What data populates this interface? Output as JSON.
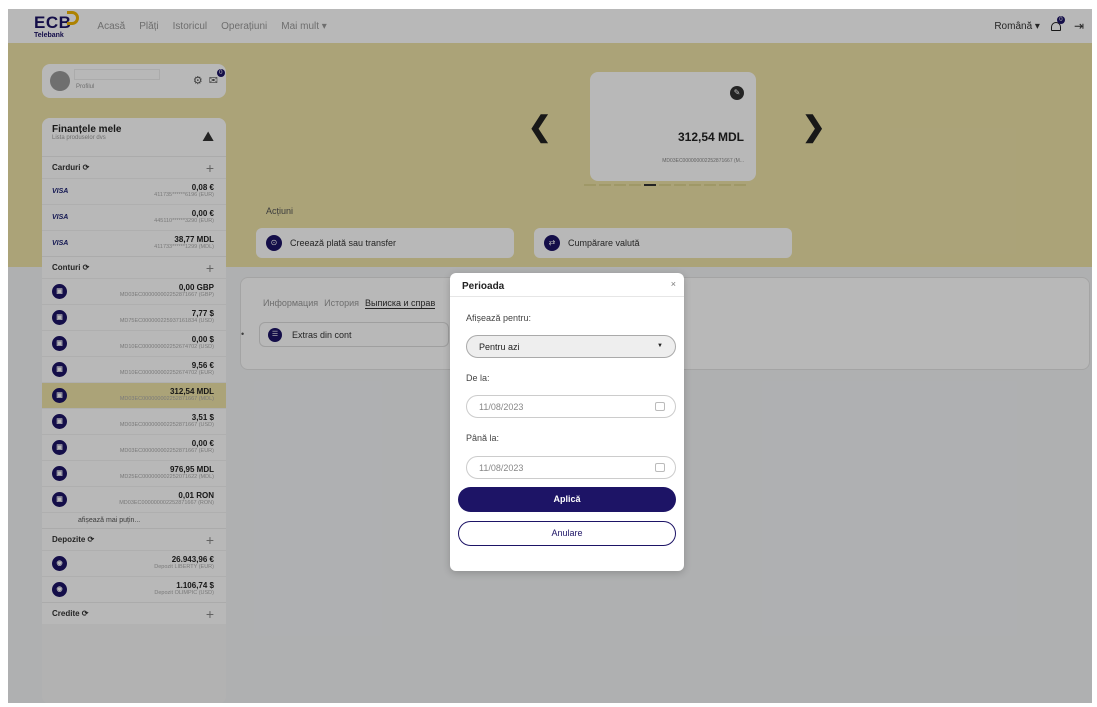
{
  "brand": {
    "logo": "ECB",
    "sub": "Telebank"
  },
  "nav": [
    "Acasă",
    "Plăți",
    "Istoricul",
    "Operațiuni",
    "Mai mult ▾"
  ],
  "header": {
    "language": "Română ▾",
    "notif_count": "0"
  },
  "profile": {
    "link": "Profilul",
    "msg_count": "0"
  },
  "finances": {
    "title": "Finanțele mele",
    "subtitle": "Lista produselor dvs"
  },
  "sections": {
    "cards": "Carduri ⟳",
    "accounts": "Conturi ⟳",
    "deposits": "Depozite ⟳",
    "credits": "Credite ⟳",
    "plus": "+"
  },
  "cards": [
    {
      "brand": "VISA",
      "amount": "0,08 €",
      "num": "411735******6196 (EUR)"
    },
    {
      "brand": "VISA",
      "amount": "0,00 €",
      "num": "445110******3290 (EUR)"
    },
    {
      "brand": "VISA",
      "amount": "38,77 MDL",
      "num": "411733******1299 (MDL)"
    }
  ],
  "accounts": [
    {
      "amount": "0,00 GBP",
      "iban": "MD03EC000000002252871667 (GBP)"
    },
    {
      "amount": "7,77 $",
      "iban": "MD75EC000000225937161834 (USD)"
    },
    {
      "amount": "0,00 $",
      "iban": "MD10EC000000002252674702 (USD)"
    },
    {
      "amount": "9,56 €",
      "iban": "MD10EC000000002252674702 (EUR)"
    },
    {
      "amount": "312,54 MDL",
      "iban": "MD03EC000000002252871667 (MDL)"
    },
    {
      "amount": "3,51 $",
      "iban": "MD03EC000000002252871667 (USD)"
    },
    {
      "amount": "0,00 €",
      "iban": "MD03EC000000002252871667 (EUR)"
    },
    {
      "amount": "976,95 MDL",
      "iban": "MD25EC000000002252071622 (MDL)"
    },
    {
      "amount": "0,01 RON",
      "iban": "MD03EC000000002252871667 (RON)"
    }
  ],
  "show_less": "afișează mai puțin...",
  "deposits": [
    {
      "amount": "26.943,96 €",
      "name": "Depozit LIBERTY (EUR)"
    },
    {
      "amount": "1.106,74 $",
      "name": "Depozit OLIMPIC (USD)"
    }
  ],
  "carousel": {
    "balance": "312,54 MDL",
    "iban": "MD03EC000000002252871667 (M...",
    "prev": "❮",
    "next": "❯"
  },
  "actions": {
    "label": "Acțiuni",
    "transfer": "Creează plată sau transfer",
    "exchange": "Cumpărare valută"
  },
  "tabs": {
    "t1": "Информация",
    "t2": "История",
    "t3": "Выписка и справ"
  },
  "extras": "Extras din cont",
  "modal": {
    "title": "Perioada",
    "close": "×",
    "show_for": "Afișează pentru:",
    "period_value": "Pentru azi",
    "from_label": "De la:",
    "from_value": "11/08/2023",
    "to_label": "Până la:",
    "to_value": "11/08/2023",
    "apply": "Aplică",
    "cancel": "Anulare"
  }
}
